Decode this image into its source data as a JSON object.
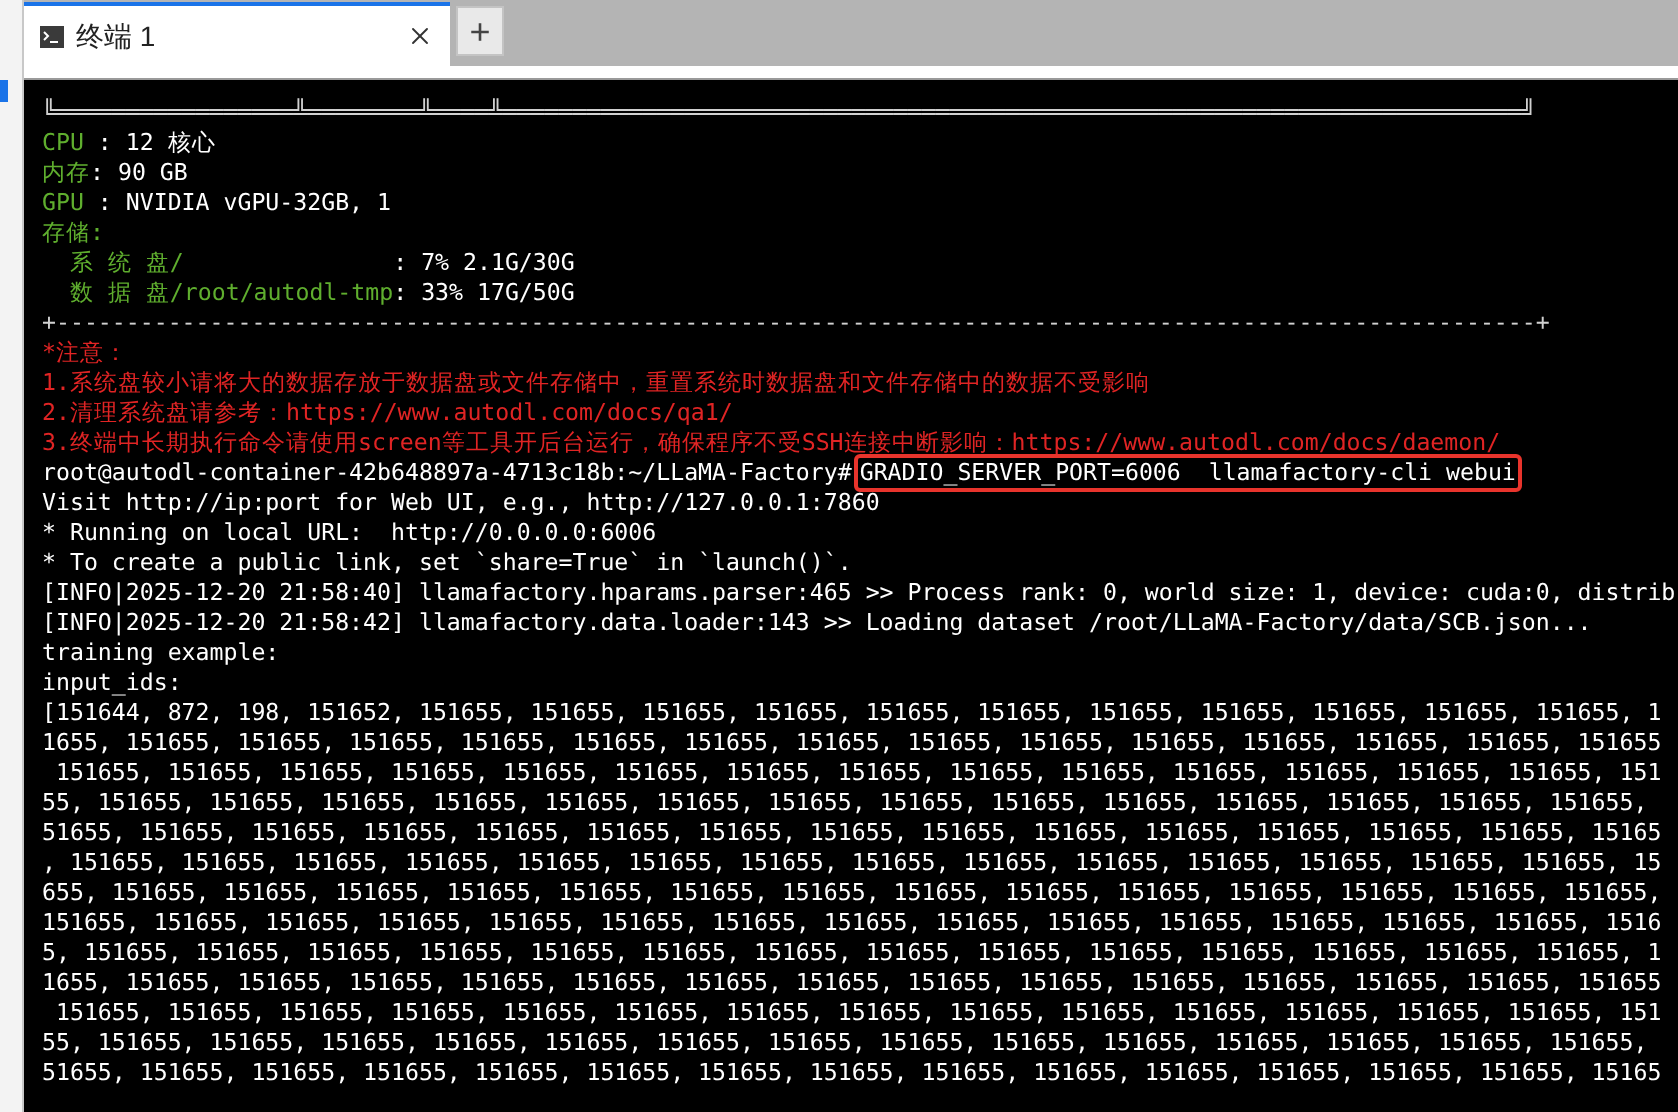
{
  "tabs": [
    {
      "title": "终端 1",
      "selected": true
    }
  ],
  "new_tab_button": "+",
  "terminal": {
    "lines": [
      {
        "kind": "rule",
        "text": "╚═════════════════╩════════╩════╩═════════════════════════════════════════════════════════════════════════╝"
      },
      {
        "kind": "info",
        "label": "CPU ",
        "value": ": 12 核心"
      },
      {
        "kind": "info",
        "label": "内存",
        "value": ": 90 GB"
      },
      {
        "kind": "info",
        "label": "GPU ",
        "value": ": NVIDIA vGPU-32GB, 1"
      },
      {
        "kind": "info",
        "label": "存储:"
      },
      {
        "kind": "info",
        "label": "  系 统 盘/               ",
        "value": ": 7% 2.1G/30G"
      },
      {
        "kind": "info",
        "label": "  数 据 盘/root/autodl-tmp",
        "value": ": 33% 17G/50G"
      },
      {
        "kind": "rule",
        "text": "+----------------------------------------------------------------------------------------------------------+"
      },
      {
        "kind": "notice",
        "text": "*注意："
      },
      {
        "kind": "notice",
        "text": "1.系统盘较小请将大的数据存放于数据盘或文件存储中，重置系统时数据盘和文件存储中的数据不受影响"
      },
      {
        "kind": "notice",
        "text": "2.清理系统盘请参考：https://www.autodl.com/docs/qa1/"
      },
      {
        "kind": "notice",
        "text": "3.终端中长期执行命令请使用screen等工具开后台运行，确保程序不受SSH连接中断影响：https://www.autodl.com/docs/daemon/"
      },
      {
        "kind": "prompt",
        "prompt": "root@autodl-container-42b648897a-4713c18b:~/LLaMA-Factory#",
        "command": "GRADIO_SERVER_PORT=6006  llamafactory-cli webui",
        "highlighted": true
      },
      {
        "kind": "output",
        "text": "Visit http://ip:port for Web UI, e.g., http://127.0.0.1:7860"
      },
      {
        "kind": "output",
        "text": "* Running on local URL:  http://0.0.0.0:6006"
      },
      {
        "kind": "output",
        "text": "* To create a public link, set `share=True` in `launch()`."
      },
      {
        "kind": "output",
        "text": "[INFO|2025-12-20 21:58:40] llamafactory.hparams.parser:465 >> Process rank: 0, world size: 1, device: cuda:0, distrib"
      },
      {
        "kind": "output",
        "text": "[INFO|2025-12-20 21:58:42] llamafactory.data.loader:143 >> Loading dataset /root/LLaMA-Factory/data/SCB.json..."
      },
      {
        "kind": "output",
        "text": "training example:"
      },
      {
        "kind": "output",
        "text": "input_ids:"
      },
      {
        "kind": "output",
        "text": "[151644, 872, 198, 151652, 151655, 151655, 151655, 151655, 151655, 151655, 151655, 151655, 151655, 151655, 151655, 1"
      },
      {
        "kind": "output",
        "text": "1655, 151655, 151655, 151655, 151655, 151655, 151655, 151655, 151655, 151655, 151655, 151655, 151655, 151655, 151655"
      },
      {
        "kind": "output",
        "text": " 151655, 151655, 151655, 151655, 151655, 151655, 151655, 151655, 151655, 151655, 151655, 151655, 151655, 151655, 151"
      },
      {
        "kind": "output",
        "text": "55, 151655, 151655, 151655, 151655, 151655, 151655, 151655, 151655, 151655, 151655, 151655, 151655, 151655, 151655,"
      },
      {
        "kind": "output",
        "text": "51655, 151655, 151655, 151655, 151655, 151655, 151655, 151655, 151655, 151655, 151655, 151655, 151655, 151655, 15165"
      },
      {
        "kind": "output",
        "text": ", 151655, 151655, 151655, 151655, 151655, 151655, 151655, 151655, 151655, 151655, 151655, 151655, 151655, 151655, 15"
      },
      {
        "kind": "output",
        "text": "655, 151655, 151655, 151655, 151655, 151655, 151655, 151655, 151655, 151655, 151655, 151655, 151655, 151655, 151655,"
      },
      {
        "kind": "output",
        "text": "151655, 151655, 151655, 151655, 151655, 151655, 151655, 151655, 151655, 151655, 151655, 151655, 151655, 151655, 1516"
      },
      {
        "kind": "output",
        "text": "5, 151655, 151655, 151655, 151655, 151655, 151655, 151655, 151655, 151655, 151655, 151655, 151655, 151655, 151655, 1"
      },
      {
        "kind": "output",
        "text": "1655, 151655, 151655, 151655, 151655, 151655, 151655, 151655, 151655, 151655, 151655, 151655, 151655, 151655, 151655"
      },
      {
        "kind": "output",
        "text": " 151655, 151655, 151655, 151655, 151655, 151655, 151655, 151655, 151655, 151655, 151655, 151655, 151655, 151655, 151"
      },
      {
        "kind": "output",
        "text": "55, 151655, 151655, 151655, 151655, 151655, 151655, 151655, 151655, 151655, 151655, 151655, 151655, 151655, 151655,"
      },
      {
        "kind": "output",
        "text": "51655, 151655, 151655, 151655, 151655, 151655, 151655, 151655, 151655, 151655, 151655, 151655, 151655, 151655, 15165"
      }
    ]
  }
}
